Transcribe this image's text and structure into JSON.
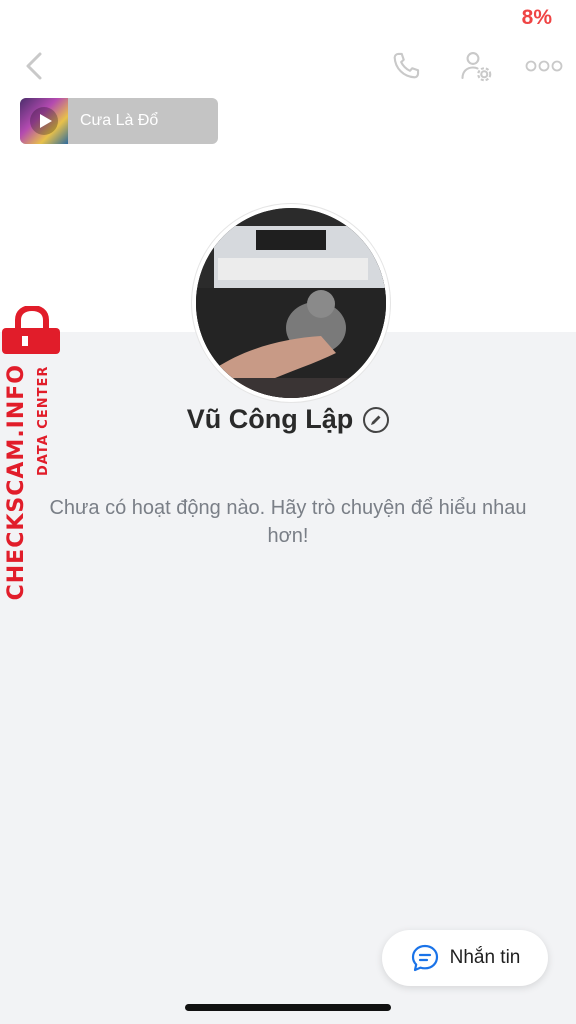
{
  "status_bar": {
    "battery": "8%"
  },
  "header": {
    "back_icon": "chevron-left-icon",
    "call_icon": "phone-icon",
    "settings_icon": "user-settings-icon",
    "more_icon": "more-dots-icon"
  },
  "music": {
    "title": "Cưa Là Đổ"
  },
  "profile": {
    "name": "Vũ Công Lập"
  },
  "feed": {
    "empty_message": "Chưa có hoạt động nào. Hãy trò chuyện để hiểu nhau hơn!"
  },
  "watermark": {
    "primary": "CHECKSCAM.INFO",
    "secondary": "DATA CENTER"
  },
  "actions": {
    "message_label": "Nhắn tin"
  },
  "colors": {
    "accent": "#1a73e8",
    "battery_low": "#ef4444",
    "watermark": "#e11d2a"
  }
}
